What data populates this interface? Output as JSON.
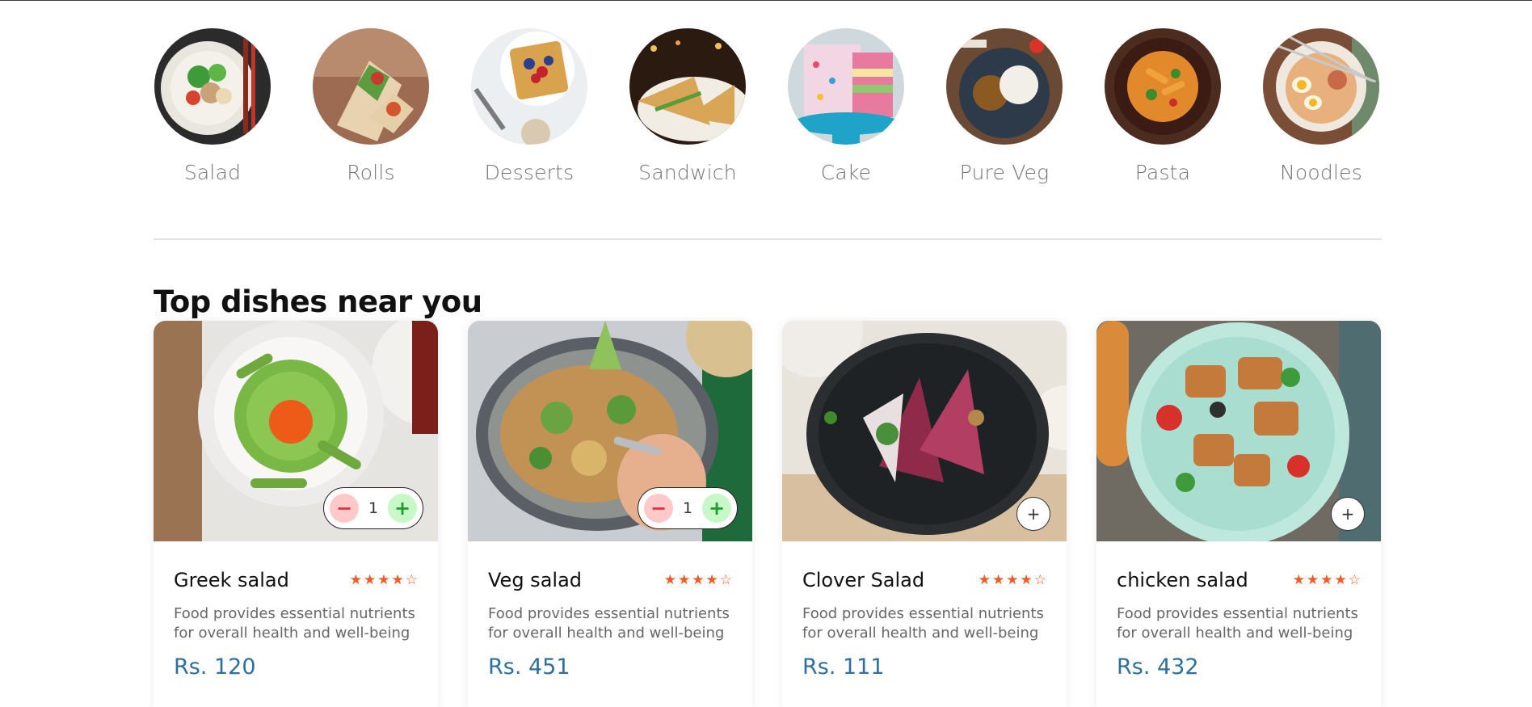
{
  "menu": {
    "items": [
      {
        "label": "Salad",
        "icon": "salad-bowl-icon"
      },
      {
        "label": "Rolls",
        "icon": "wrap-roll-icon"
      },
      {
        "label": "Desserts",
        "icon": "waffle-dessert-icon"
      },
      {
        "label": "Sandwich",
        "icon": "sandwich-icon"
      },
      {
        "label": "Cake",
        "icon": "cake-icon"
      },
      {
        "label": "Pure Veg",
        "icon": "veg-curry-icon"
      },
      {
        "label": "Pasta",
        "icon": "pasta-bowl-icon"
      },
      {
        "label": "Noodles",
        "icon": "noodle-bowl-icon"
      }
    ]
  },
  "section": {
    "title": "Top dishes near you"
  },
  "dishes": [
    {
      "name": "Greek salad",
      "rating": 4,
      "rating_max": 5,
      "description": "Food provides essential nutrients for overall health and well-being",
      "price": "Rs. 120",
      "in_cart": true,
      "quantity": "1"
    },
    {
      "name": "Veg salad",
      "rating": 4,
      "rating_max": 5,
      "description": "Food provides essential nutrients for overall health and well-being",
      "price": "Rs. 451",
      "in_cart": true,
      "quantity": "1"
    },
    {
      "name": "Clover Salad",
      "rating": 4,
      "rating_max": 5,
      "description": "Food provides essential nutrients for overall health and well-being",
      "price": "Rs. 111",
      "in_cart": false,
      "quantity": "0"
    },
    {
      "name": "chicken salad",
      "rating": 4,
      "rating_max": 5,
      "description": "Food provides essential nutrients for overall health and well-being",
      "price": "Rs. 432",
      "in_cart": false,
      "quantity": "0"
    }
  ],
  "controls": {
    "minus": "−",
    "plus": "+",
    "add": "+"
  },
  "colors": {
    "accent_price": "#2e6f9e",
    "star": "#f15a24",
    "minus_bg": "#ffc9c9",
    "plus_bg": "#c8f7c8"
  }
}
